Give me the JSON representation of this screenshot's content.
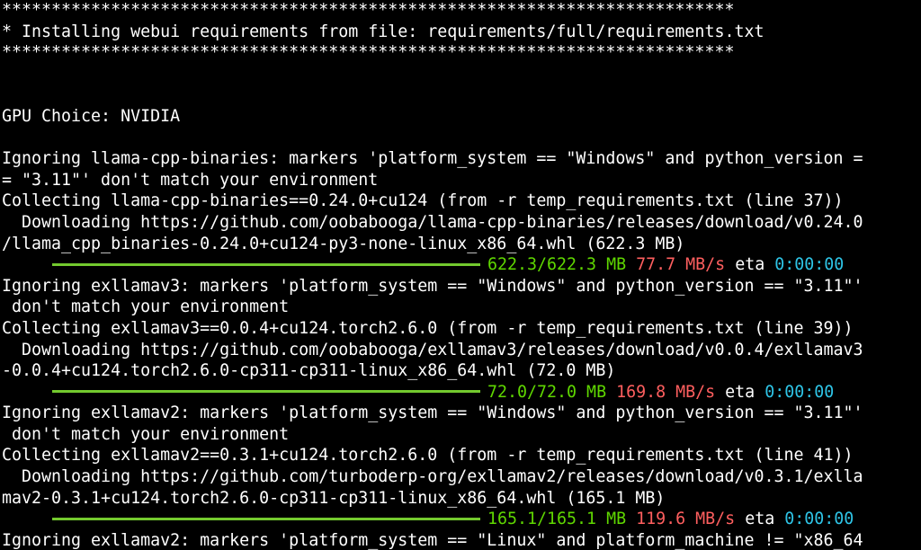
{
  "colors": {
    "background": "#000000",
    "text": "#ffffff",
    "progress_bar": "#73c92e",
    "progress_size": "#5fd700",
    "progress_speed": "#ff5f5f",
    "progress_eta": "#2ec4e6"
  },
  "lines": [
    {
      "kind": "text",
      "text": "**************************************************************************"
    },
    {
      "kind": "text",
      "text": "* Installing webui requirements from file: requirements/full/requirements.txt"
    },
    {
      "kind": "text",
      "text": "**************************************************************************"
    },
    {
      "kind": "blank",
      "text": ""
    },
    {
      "kind": "blank",
      "text": ""
    },
    {
      "kind": "text",
      "text": "GPU Choice: NVIDIA"
    },
    {
      "kind": "blank",
      "text": ""
    },
    {
      "kind": "text",
      "text": "Ignoring llama-cpp-binaries: markers 'platform_system == \"Windows\" and python_version ="
    },
    {
      "kind": "text",
      "text": "= \"3.11\"' don't match your environment"
    },
    {
      "kind": "text",
      "text": "Collecting llama-cpp-binaries==0.24.0+cu124 (from -r temp_requirements.txt (line 37))"
    },
    {
      "kind": "text",
      "text": "  Downloading https://github.com/oobabooga/llama-cpp-binaries/releases/download/v0.24.0"
    },
    {
      "kind": "text",
      "text": "/llama_cpp_binaries-0.24.0+cu124-py3-none-linux_x86_64.whl (622.3 MB)"
    },
    {
      "kind": "progress",
      "progress": 1.0,
      "size": "622.3/622.3 MB",
      "speed": "77.7 MB/s",
      "eta_label": "eta",
      "eta": "0:00:00"
    },
    {
      "kind": "text",
      "text": "Ignoring exllamav3: markers 'platform_system == \"Windows\" and python_version == \"3.11\"'"
    },
    {
      "kind": "text",
      "text": " don't match your environment"
    },
    {
      "kind": "text",
      "text": "Collecting exllamav3==0.0.4+cu124.torch2.6.0 (from -r temp_requirements.txt (line 39))"
    },
    {
      "kind": "text",
      "text": "  Downloading https://github.com/oobabooga/exllamav3/releases/download/v0.0.4/exllamav3"
    },
    {
      "kind": "text",
      "text": "-0.0.4+cu124.torch2.6.0-cp311-cp311-linux_x86_64.whl (72.0 MB)"
    },
    {
      "kind": "progress",
      "progress": 1.0,
      "size": "72.0/72.0 MB",
      "speed": "169.8 MB/s",
      "eta_label": "eta",
      "eta": "0:00:00"
    },
    {
      "kind": "text",
      "text": "Ignoring exllamav2: markers 'platform_system == \"Windows\" and python_version == \"3.11\"'"
    },
    {
      "kind": "text",
      "text": " don't match your environment"
    },
    {
      "kind": "text",
      "text": "Collecting exllamav2==0.3.1+cu124.torch2.6.0 (from -r temp_requirements.txt (line 41))"
    },
    {
      "kind": "text",
      "text": "  Downloading https://github.com/turboderp-org/exllamav2/releases/download/v0.3.1/exlla"
    },
    {
      "kind": "text",
      "text": "mav2-0.3.1+cu124.torch2.6.0-cp311-cp311-linux_x86_64.whl (165.1 MB)"
    },
    {
      "kind": "progress",
      "progress": 1.0,
      "size": "165.1/165.1 MB",
      "speed": "119.6 MB/s",
      "eta_label": "eta",
      "eta": "0:00:00"
    },
    {
      "kind": "text",
      "text": "Ignoring exllamav2: markers 'platform_system == \"Linux\" and platform_machine != \"x86_64"
    }
  ]
}
